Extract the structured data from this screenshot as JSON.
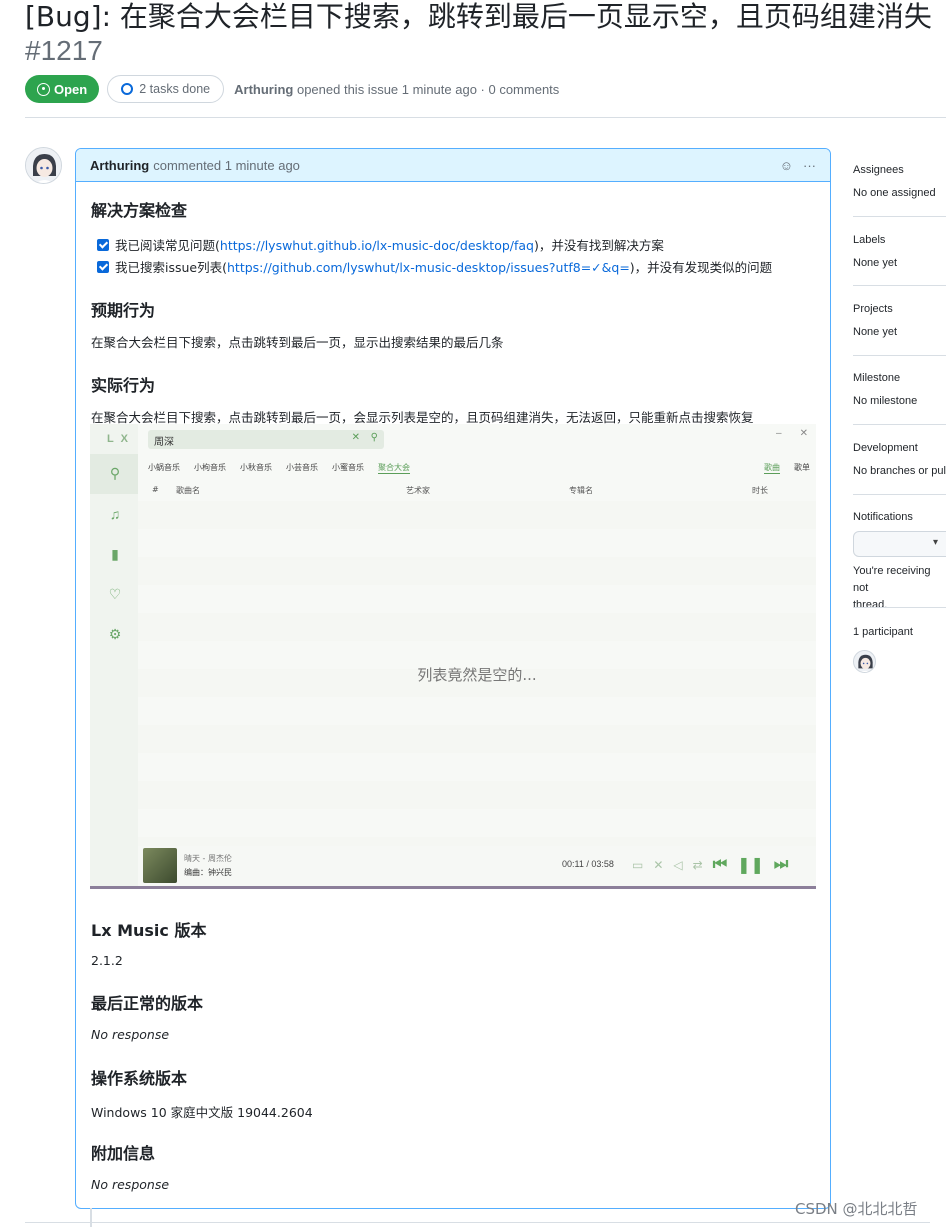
{
  "issue": {
    "title": "[Bug]: 在聚合大会栏目下搜索，跳转到最后一页显示空，且页码组建消失",
    "number": "#1217",
    "state": "Open",
    "tasks": "2 tasks done",
    "author": "Arthuring",
    "meta": "opened this issue 1 minute ago · 0 comments"
  },
  "comment": {
    "author": "Arthuring",
    "time": "commented 1 minute ago",
    "sections": {
      "checks_title": "解决方案检查",
      "check1_pre": "我已阅读常见问题(",
      "check1_link": "https://lyswhut.github.io/lx-music-doc/desktop/faq",
      "check1_post": ")，并没有找到解决方案",
      "check2_pre": "我已搜索issue列表(",
      "check2_link": "https://github.com/lyswhut/lx-music-desktop/issues?utf8=✓&q=",
      "check2_post": ")，并没有发现类似的问题",
      "expected_title": "预期行为",
      "expected_text": "在聚合大会栏目下搜索，点击跳转到最后一页，显示出搜索结果的最后几条",
      "actual_title": "实际行为",
      "actual_text": "在聚合大会栏目下搜索，点击跳转到最后一页，会显示列表是空的，且页码组建消失，无法返回，只能重新点击搜索恢复",
      "version_title": "Lx Music 版本",
      "version_text": "2.1.2",
      "last_ok_title": "最后正常的版本",
      "last_ok_text": "No response",
      "os_title": "操作系统版本",
      "os_text": "Windows 10 家庭中文版 19044.2604",
      "extra_title": "附加信息",
      "extra_text": "No response"
    }
  },
  "embedded_app": {
    "logo": "L X",
    "search_value": "周深",
    "source_tabs": [
      "小蜗音乐",
      "小枸音乐",
      "小秋音乐",
      "小芸音乐",
      "小蜜音乐",
      "聚合大会"
    ],
    "active_source": "聚合大会",
    "type_tabs": [
      "歌曲",
      "歌单"
    ],
    "columns": [
      "#",
      "歌曲名",
      "艺术家",
      "专辑名",
      "时长"
    ],
    "empty_message": "列表竟然是空的...",
    "player": {
      "song": "晴天 - 周杰伦",
      "arranger": "编曲：钟兴民",
      "time_current": "00:11",
      "time_sep": "/",
      "time_total": "03:58"
    }
  },
  "sidebar": {
    "assignees_label": "Assignees",
    "assignees_value": "No one assigned",
    "labels_label": "Labels",
    "labels_value": "None yet",
    "projects_label": "Projects",
    "projects_value": "None yet",
    "milestone_label": "Milestone",
    "milestone_value": "No milestone",
    "development_label": "Development",
    "development_value": "No branches or pull",
    "notifications_label": "Notifications",
    "notifications_text_1": "You're receiving not",
    "notifications_text_2": "thread.",
    "participants_label": "1 participant"
  },
  "watermark": "CSDN @北北北哲"
}
